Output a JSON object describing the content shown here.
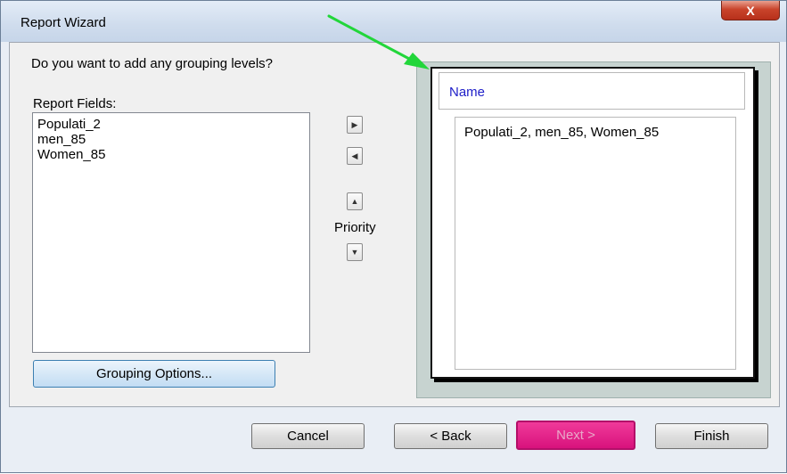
{
  "window": {
    "title": "Report Wizard",
    "close_glyph": "X"
  },
  "wizard": {
    "question": "Do you want to add any grouping levels?",
    "fields_label": "Report Fields:",
    "fields": [
      "Populati_2",
      "men_85",
      "Women_85"
    ],
    "grouping_options_label": "Grouping Options...",
    "priority_label": "Priority",
    "move_right_glyph": "▶",
    "move_left_glyph": "◀",
    "priority_up_glyph": "▲",
    "priority_down_glyph": "▼"
  },
  "preview": {
    "group_header": "Name",
    "detail_text": "Populati_2, men_85, Women_85"
  },
  "buttons": {
    "cancel": "Cancel",
    "back": "< Back",
    "next": "Next >",
    "finish": "Finish"
  },
  "colors": {
    "next_highlight": "#d8127d",
    "annotation_arrow": "#22d63a",
    "group_header_text": "#1e1ec8"
  },
  "icons": {
    "close": "close-icon",
    "annotation": "green-arrow-icon"
  }
}
